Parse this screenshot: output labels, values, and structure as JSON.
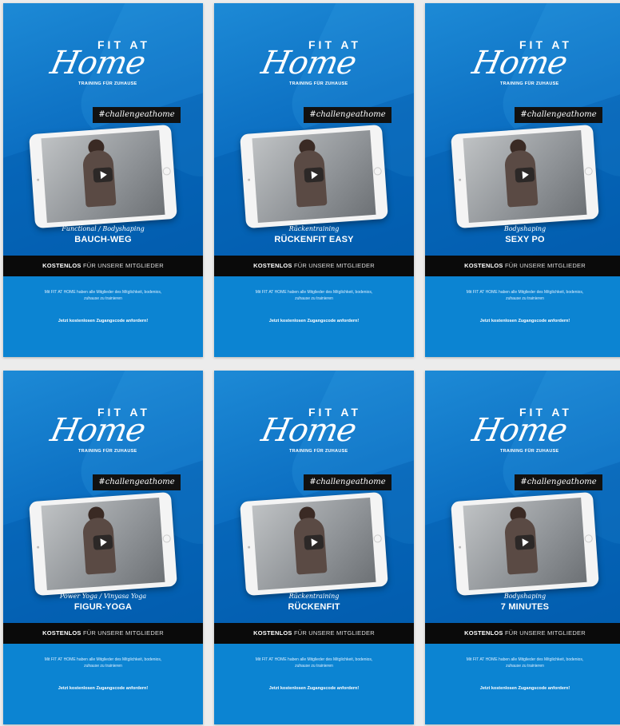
{
  "cards": [
    {
      "logo_top": "FIT AT",
      "logo_main": "Home",
      "logo_sub": "TRAINING FÜR ZUHAUSE",
      "hashtag": "#challengeathome",
      "kicker": "Functional / Bodyshaping",
      "title": "BAUCH-WEG",
      "banner_bold": "KOSTENLOS",
      "banner_rest": "FÜR UNSERE MITGLIEDER",
      "desc": "Mit FIT AT HOME haben alle Mitglieder des Mitglichkeit, bodenios, zuhause zu trainieren",
      "cta": "Jetzt kostenlosen Zugangscode anfordern!"
    },
    {
      "logo_top": "FIT AT",
      "logo_main": "Home",
      "logo_sub": "TRAINING FÜR ZUHAUSE",
      "hashtag": "#challengeathome",
      "kicker": "Rückentraining",
      "title": "RÜCKENFIT EASY",
      "banner_bold": "KOSTENLOS",
      "banner_rest": "FÜR UNSERE MITGLIEDER",
      "desc": "Mit FIT AT HOME haben alle Mitglieder des Mitglichkeit, bodenios, zuhause zu trainieren",
      "cta": "Jetzt kostenlosen Zugangscode anfordern!"
    },
    {
      "logo_top": "FIT AT",
      "logo_main": "Home",
      "logo_sub": "TRAINING FÜR ZUHAUSE",
      "hashtag": "#challengeathome",
      "kicker": "Bodyshaping",
      "title": "SEXY PO",
      "banner_bold": "KOSTENLOS",
      "banner_rest": "FÜR UNSERE MITGLIEDER",
      "desc": "Mit FIT AT HOME haben alle Mitglieder des Mitglichkeit, bodenios, zuhause zu trainieren",
      "cta": "Jetzt kostenlosen Zugangscode anfordern!"
    },
    {
      "logo_top": "FIT AT",
      "logo_main": "Home",
      "logo_sub": "TRAINING FÜR ZUHAUSE",
      "hashtag": "#challengeathome",
      "kicker": "Power Yoga / Vinyasa Yoga",
      "title": "FIGUR-YOGA",
      "banner_bold": "KOSTENLOS",
      "banner_rest": "FÜR UNSERE MITGLIEDER",
      "desc": "Mit FIT AT HOME haben alle Mitglieder des Mitglichkeit, bodenios, zuhause zu trainieren",
      "cta": "Jetzt kostenlosen Zugangscode anfordern!"
    },
    {
      "logo_top": "FIT AT",
      "logo_main": "Home",
      "logo_sub": "TRAINING FÜR ZUHAUSE",
      "hashtag": "#challengeathome",
      "kicker": "Rückentraining",
      "title": "RÜCKENFIT",
      "banner_bold": "KOSTENLOS",
      "banner_rest": "FÜR UNSERE MITGLIEDER",
      "desc": "Mit FIT AT HOME haben alle Mitglieder des Mitglichkeit, bodenios, zuhause zu trainieren",
      "cta": "Jetzt kostenlosen Zugangscode anfordern!"
    },
    {
      "logo_top": "FIT AT",
      "logo_main": "Home",
      "logo_sub": "TRAINING FÜR ZUHAUSE",
      "hashtag": "#challengeathome",
      "kicker": "Bodyshaping",
      "title": "7 MINUTES",
      "banner_bold": "KOSTENLOS",
      "banner_rest": "FÜR UNSERE MITGLIEDER",
      "desc": "Mit FIT AT HOME haben alle Mitglieder des Mitglichkeit, bodenios, zuhause zu trainieren",
      "cta": "Jetzt kostenlosen Zugangscode anfordern!"
    }
  ],
  "colors": {
    "card_blue": "#0a6cc0",
    "banner_black": "#0a0a0a",
    "bottom_blue": "#0c84d2"
  },
  "icons": {
    "play": "play-icon"
  }
}
